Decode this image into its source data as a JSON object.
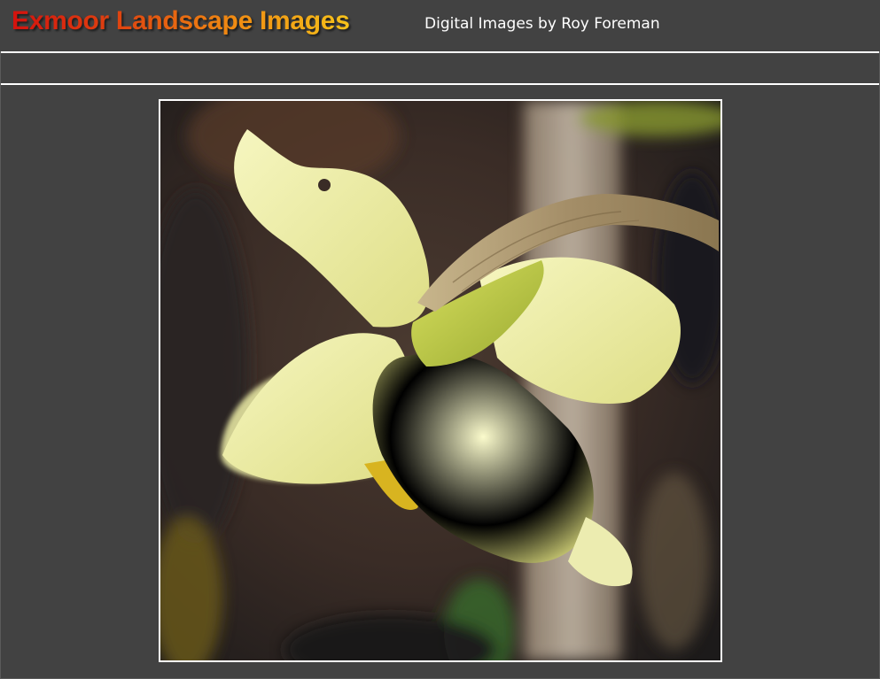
{
  "header": {
    "site_title": "Exmoor Landscape Images",
    "subtitle": "Digital Images by Roy Foreman"
  },
  "photo": {
    "subject": "daffodil-photo",
    "colors": {
      "background_dark": "#2a2420",
      "petal": "#f0f0b0",
      "petal_shade": "#d8d87a",
      "stem": "#c4d040",
      "dry_spathe": "#a48e68"
    }
  },
  "theme": {
    "page_bg": "#424242",
    "rule": "#ffffff",
    "title_gradient": [
      "#d4120e",
      "#f6c21a"
    ]
  }
}
